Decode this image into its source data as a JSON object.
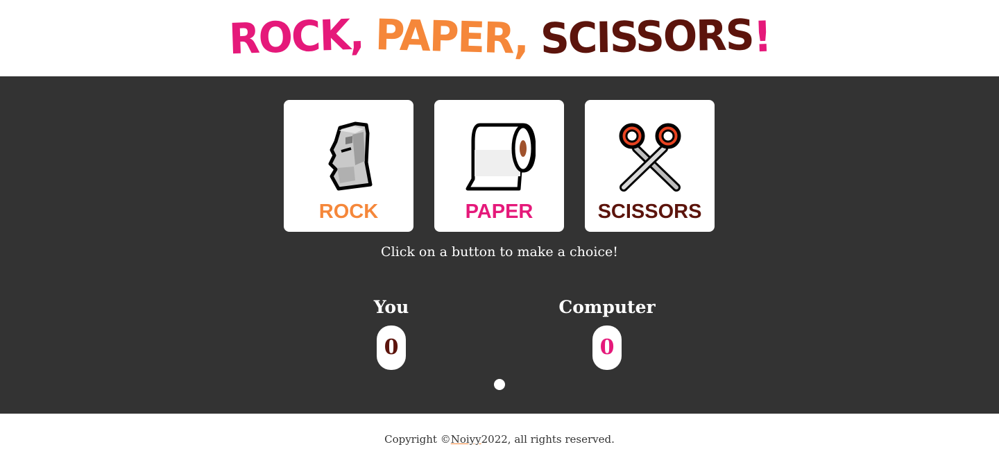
{
  "header": {
    "title_word1": "ROCK,",
    "title_word2": "PAPER,",
    "title_word3": "SCISSORS",
    "title_exclaim": "!"
  },
  "choices": [
    {
      "label": "ROCK",
      "icon": "moai-icon",
      "color": "#f5873a"
    },
    {
      "label": "PAPER",
      "icon": "toilet-paper-icon",
      "color": "#e5197a"
    },
    {
      "label": "SCISSORS",
      "icon": "scissors-icon",
      "color": "#5c140c"
    }
  ],
  "prompt": "Click on a button to make a choice!",
  "scores": {
    "player": {
      "name": "You",
      "value": "0",
      "color": "#5c140c"
    },
    "computer": {
      "name": "Computer",
      "value": "0",
      "color": "#e5197a"
    }
  },
  "footer": {
    "prefix": "Copyright © ",
    "author": "Noiyy",
    "suffix": " 2022, all rights reserved."
  },
  "colors": {
    "pink": "#e5197a",
    "orange": "#f5873a",
    "maroon": "#5c140c",
    "background_dark": "#333333"
  }
}
